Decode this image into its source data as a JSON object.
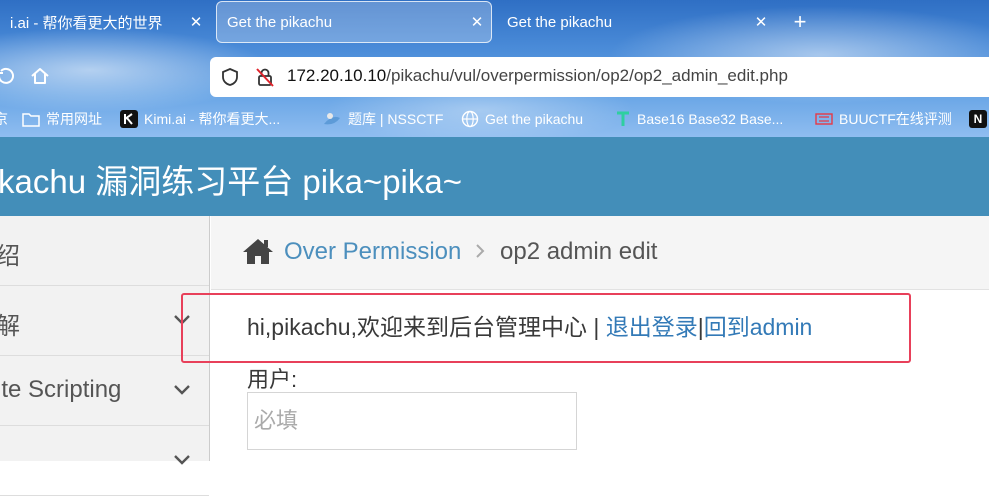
{
  "browser": {
    "tabs": [
      {
        "title": "i.ai - 帮你看更大的世界",
        "active": false
      },
      {
        "title": "Get the pikachu",
        "active": true
      },
      {
        "title": "Get the pikachu",
        "active": false
      }
    ],
    "new_tab_label": "+",
    "url": {
      "host": "172.20.10.10",
      "path": "/pikachu/vul/overpermission/op2/op2_admin_edit.php"
    },
    "bookmarks": [
      {
        "label": "京",
        "icon": "partial-icon"
      },
      {
        "label": "常用网址",
        "icon": "folder-icon"
      },
      {
        "label": "Kimi.ai - 帮你看更大...",
        "icon": "kimi-logo-icon"
      },
      {
        "label": "题库 | NSSCTF",
        "icon": "nssctf-logo-icon"
      },
      {
        "label": "Get the pikachu",
        "icon": "globe-icon"
      },
      {
        "label": "Base16 Base32 Base...",
        "icon": "base-logo-icon"
      },
      {
        "label": "BUUCTF在线评测",
        "icon": "buuctf-logo-icon"
      },
      {
        "label": "N",
        "icon": "notion-logo-icon"
      }
    ]
  },
  "site": {
    "title": "kachu 漏洞练习平台 pika~pika~",
    "header_color": "#438eb9"
  },
  "sidebar": {
    "items": [
      {
        "label": "绍",
        "expandable": false
      },
      {
        "label": "解",
        "expandable": true
      },
      {
        "label": "ite Scripting",
        "expandable": true
      },
      {
        "label": "",
        "expandable": true
      }
    ]
  },
  "breadcrumb": {
    "parent": "Over Permission",
    "current": "op2 admin edit"
  },
  "main": {
    "welcome_text": "hi,pikachu,欢迎来到后台管理中心 | ",
    "logout_link": "退出登录",
    "separator": "|",
    "back_link": "回到admin",
    "user_label": "用户:",
    "user_placeholder": "必填",
    "user_value": ""
  },
  "colors": {
    "link": "#337ab7",
    "highlight_border": "#e8405a"
  }
}
